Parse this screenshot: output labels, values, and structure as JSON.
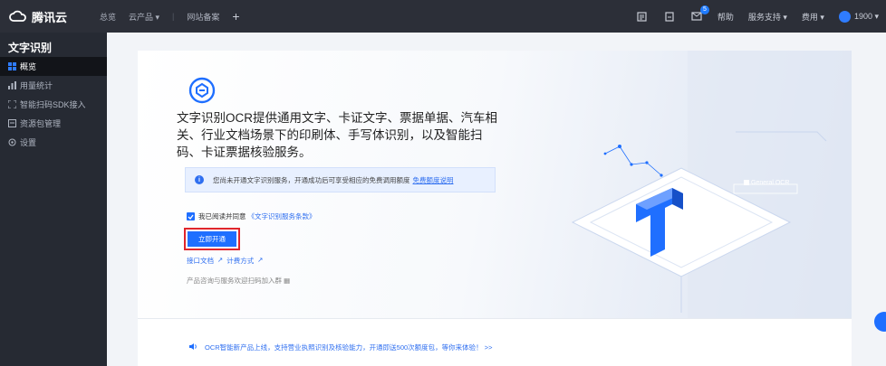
{
  "topbar": {
    "logo_text": "腾讯云",
    "nav": {
      "home": "总览",
      "products": "云产品 ▾",
      "site": "网站备案",
      "add": "+"
    },
    "right": {
      "help": "帮助",
      "support": "服务支持 ▾",
      "fees": "费用 ▾",
      "account": "1900 ▾",
      "message_count": "5"
    }
  },
  "sidebar": {
    "title": "文字识别",
    "items": [
      {
        "label": "概览",
        "icon": "grid-icon"
      },
      {
        "label": "用量统计",
        "icon": "bar-chart-icon"
      },
      {
        "label": "智能扫码SDK接入",
        "icon": "scan-icon"
      },
      {
        "label": "资源包管理",
        "icon": "package-icon"
      },
      {
        "label": "设置",
        "icon": "gear-icon"
      }
    ]
  },
  "hero": {
    "title": "文字识别OCR提供通用文字、卡证文字、票据单据、汽车相关、行业文档场景下的印刷体、手写体识别，以及智能扫码、卡证票据核验服务。",
    "notice": "您尚未开通文字识别服务，开通成功后可享受相应的免费调用额度",
    "notice_link": "免费额度说明",
    "agree_text": "我已阅读并同意",
    "agree_link": "《文字识别服务条款》",
    "open_button": "立即开通",
    "link_docs": "接口文档",
    "link_pricing": "计费方式",
    "qr_text": "产品咨询与服务欢迎扫码加入群",
    "panel_label": "General OCR"
  },
  "bottom": {
    "announcement": "OCR智能新产品上线，支持营业执照识别及核验能力，开通即送500次额度包，等你来体验！ >>"
  },
  "colors": {
    "primary": "#1f6fff",
    "topbar": "#2c2f38",
    "sidebar": "#262a33",
    "highlight": "#e0262c"
  }
}
